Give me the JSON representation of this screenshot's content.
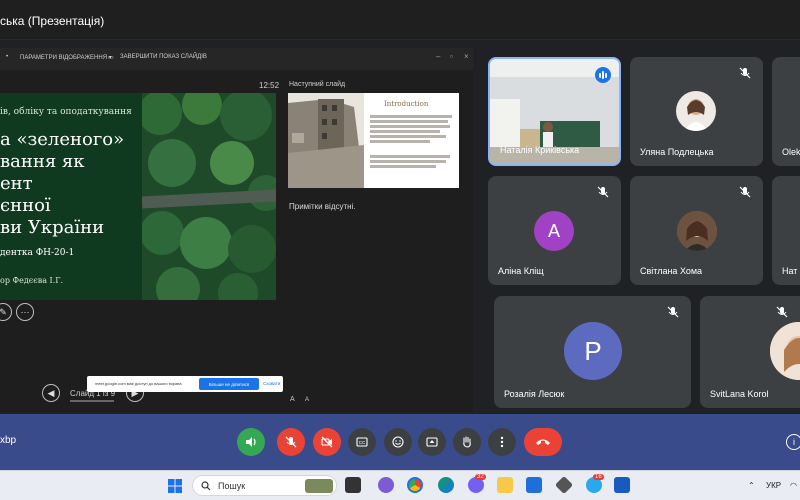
{
  "window": {
    "title": "ська (Презентація)"
  },
  "presenter_toolbar": {
    "display_settings": "ПАРАМЕТРИ ВІДОБРАЖЕННЯ ▾",
    "end_show": "ЗАВЕРШИТИ ПОКАЗ СЛАЙДІВ"
  },
  "presenter": {
    "clock": "12:52",
    "next_slide_label": "Наступний слайд",
    "notes": "Примітки відсутні.",
    "slide_counter": "Слайд 1 із 9",
    "text_size_up": "A",
    "text_size_down": "A"
  },
  "current_slide": {
    "lines": [
      "ів, обліку та оподаткування",
      "а «зеленого»",
      "вання як",
      "ент",
      "єнної",
      "ви України",
      "дентка ФН-20-1",
      "ор Федєєва І.Г."
    ]
  },
  "next_slide": {
    "title": "Introduction"
  },
  "popup": {
    "text": "meet.google.com має доступ до вашого екрана",
    "stop_button": "Більше не ділитися",
    "hide_link": "Сховати"
  },
  "participants": [
    {
      "name": "Наталія Криківська",
      "muted": false,
      "speaking": true
    },
    {
      "name": "Уляна Подлецька",
      "muted": true
    },
    {
      "name": "Olek",
      "muted": true
    },
    {
      "name": "Аліна Кліщ",
      "muted": true,
      "letter": "А",
      "color": "#a142c4"
    },
    {
      "name": "Світлана Хома",
      "muted": true
    },
    {
      "name": "Нат",
      "muted": true
    },
    {
      "name": "Розалія Лесюк",
      "muted": true,
      "letter": "Р",
      "color": "#5c6bc0"
    },
    {
      "name": "SvitLana Korol",
      "muted": true
    }
  ],
  "meeting": {
    "code_fragment": "xbp"
  },
  "taskbar": {
    "search_placeholder": "Пошук",
    "language": "УКР",
    "badge_viber": "32",
    "badge_telegram": "16"
  },
  "colors": {
    "accent_blue": "#8ab4f8",
    "end_call_red": "#ea4335",
    "control_bar": "#3a4b8c",
    "mic_on_green": "#34a853"
  }
}
